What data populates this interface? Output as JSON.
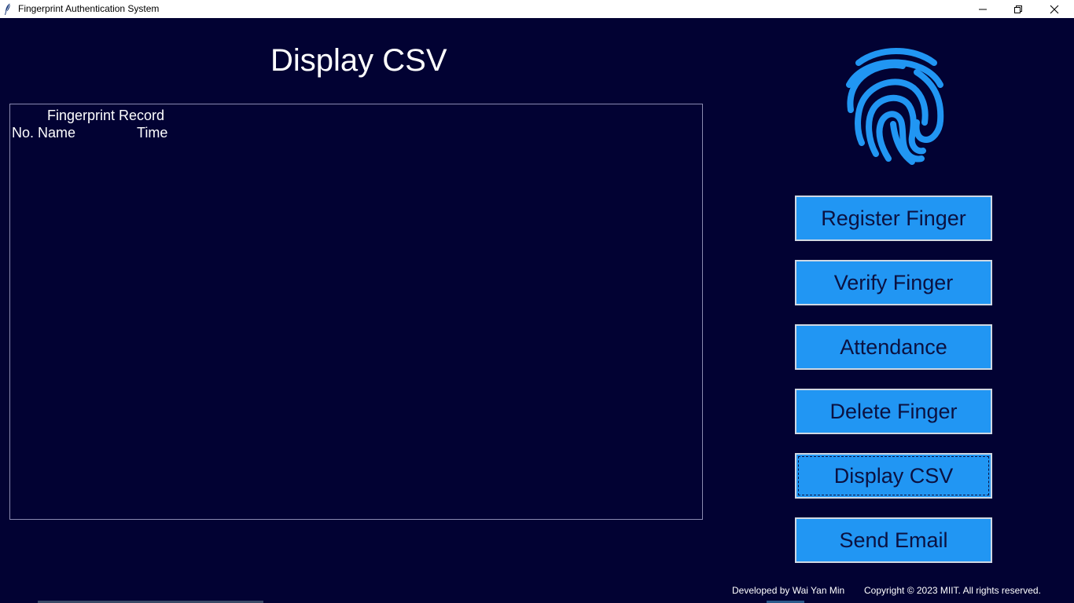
{
  "window": {
    "title": "Fingerprint Authentication System",
    "app_icon": "feather-icon",
    "controls": {
      "minimize_icon": "minimize-icon",
      "maximize_icon": "restore-icon",
      "close_icon": "close-icon"
    }
  },
  "main": {
    "page_title": "Display CSV",
    "record_panel": {
      "title": "Fingerprint Record",
      "columns": [
        "No.",
        "Name",
        "Time"
      ],
      "rows": []
    }
  },
  "sidebar": {
    "logo_icon": "fingerprint-icon",
    "buttons": [
      {
        "label": "Register Finger"
      },
      {
        "label": "Verify Finger"
      },
      {
        "label": "Attendance"
      },
      {
        "label": "Delete Finger"
      },
      {
        "label": "Display CSV"
      },
      {
        "label": "Send Email"
      }
    ],
    "focused_button": "Display CSV"
  },
  "footer": {
    "developer": "Developed by Wai Yan Min",
    "copyright": "Copyright © 2023 MIIT. All rights reserved."
  },
  "colors": {
    "background": "#020233",
    "button_fill": "#2196f3",
    "button_text": "#0b1140",
    "logo": "#2196f3",
    "text": "#ffffff"
  }
}
